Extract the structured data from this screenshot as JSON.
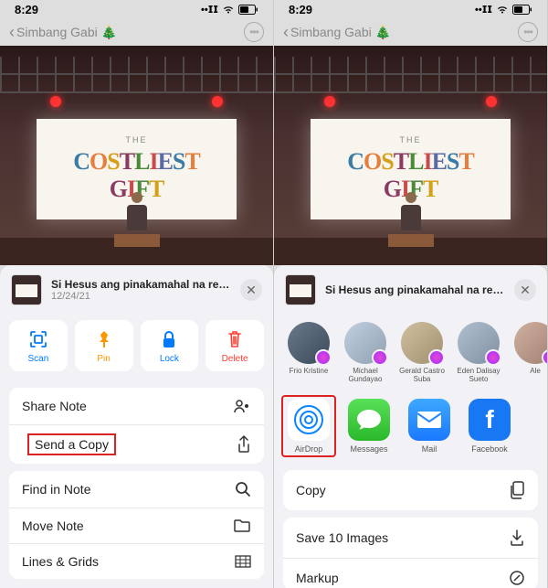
{
  "status": {
    "time": "8:29"
  },
  "nav": {
    "back_label": "Simbang Gabi 🎄"
  },
  "note_image": {
    "screen_the": "THE",
    "screen_word1": "COSTLIEST",
    "screen_word2": "GIFT"
  },
  "sheet_left": {
    "title": "Si Hesus ang pinakamahal na regalo.",
    "date": "12/24/21",
    "actions": {
      "scan": "Scan",
      "pin": "Pin",
      "lock": "Lock",
      "delete": "Delete"
    },
    "menu1": {
      "share_note": "Share Note",
      "send_copy": "Send a Copy"
    },
    "menu2": {
      "find": "Find in Note",
      "move": "Move Note",
      "lines": "Lines & Grids"
    }
  },
  "sheet_right": {
    "title": "Si Hesus ang pinakamahal na regalo.",
    "contacts": [
      {
        "name": "Frio Kristine"
      },
      {
        "name": "Michael Gundayao"
      },
      {
        "name": "Gerald Castro Suba"
      },
      {
        "name": "Eden Dalisay Sueto"
      },
      {
        "name": "Ale"
      }
    ],
    "apps": {
      "airdrop": "AirDrop",
      "messages": "Messages",
      "mail": "Mail",
      "facebook": "Facebook"
    },
    "actions": {
      "copy": "Copy",
      "save_images": "Save 10 Images",
      "markup": "Markup"
    }
  }
}
